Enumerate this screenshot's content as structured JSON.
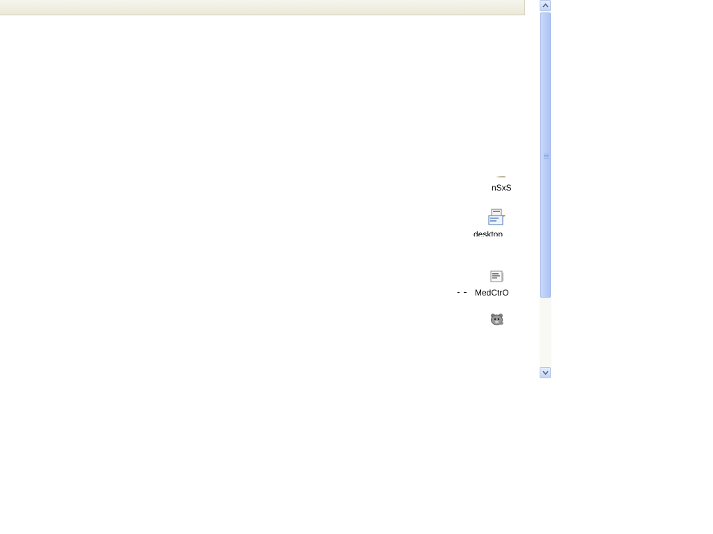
{
  "files": [
    {
      "label": "nSxS",
      "icon": "folder-icon"
    },
    {
      "label": "desktop",
      "icon": "ini-file-icon"
    },
    {
      "label": "MedCtrO",
      "icon": "text-file-icon"
    },
    {
      "label": "",
      "icon": "bear-icon"
    }
  ],
  "colors": {
    "toolbar": "#ece9d8",
    "scrollbar_thumb": "#b9cdf7",
    "scrollbar_track": "#f8f8f4"
  }
}
